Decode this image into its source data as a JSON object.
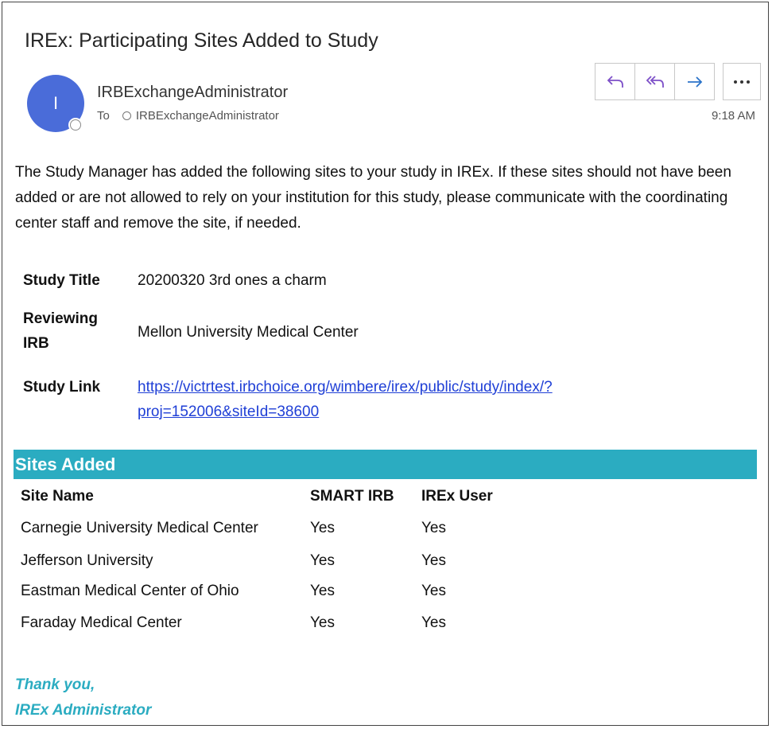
{
  "email": {
    "subject": "IREx: Participating Sites Added to Study",
    "avatar_initial": "I",
    "sender": "IRBExchangeAdministrator",
    "to_prefix": "To",
    "to_recipient": "IRBExchangeAdministrator",
    "time": "9:18 AM",
    "actions": {
      "reply_icon": "reply-icon",
      "reply_all_icon": "reply-all-icon",
      "forward_icon": "forward-icon",
      "more_icon": "more-options-icon",
      "reply_glyph": "↶",
      "reply_all_glyph": "⮜",
      "forward_glyph": "→",
      "more_glyph": "···"
    }
  },
  "body": {
    "paragraph": "The Study Manager has added the following sites to your study in IREx. If these sites should not have been added or are not allowed to rely on your institution for this study, please communicate with the coordinating center staff and remove the site, if needed."
  },
  "study": {
    "title_label": "Study Title",
    "title_value": "20200320 3rd ones a charm",
    "irb_label": "Reviewing IRB",
    "irb_value": "Mellon University Medical Center",
    "link_label": "Study Link",
    "link_value_line1": "https://victrtest.irbchoice.org/wimbere/irex/public/study/index/?",
    "link_value_line2": "proj=152006&siteId=38600"
  },
  "sites": {
    "heading": "Sites Added",
    "columns": [
      "Site Name",
      "SMART IRB",
      "IREx User"
    ],
    "rows": [
      [
        "Carnegie University Medical Center",
        "Yes",
        "Yes"
      ],
      [
        "Jefferson University",
        "Yes",
        "Yes"
      ],
      [
        "Eastman Medical Center of Ohio",
        "Yes",
        "Yes"
      ],
      [
        "Faraday Medical Center",
        "Yes",
        "Yes"
      ]
    ]
  },
  "signature": {
    "line1": "Thank you,",
    "line2": "IREx Administrator"
  },
  "colors": {
    "avatar": "#4a6cd9",
    "band": "#2bacc1",
    "link": "#1f3fd6",
    "action_icon": "#7d50c8"
  }
}
